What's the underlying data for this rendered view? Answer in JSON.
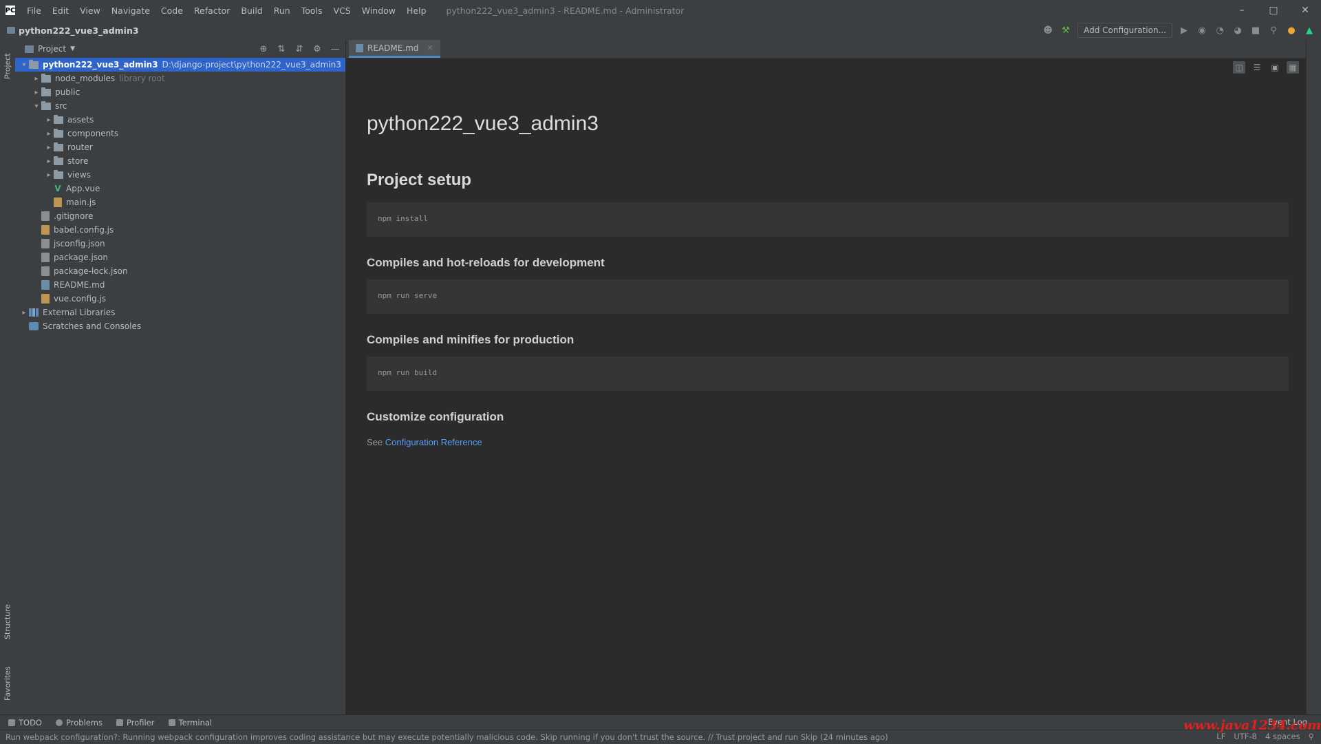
{
  "titlebar": {
    "menu": [
      "File",
      "Edit",
      "View",
      "Navigate",
      "Code",
      "Refactor",
      "Build",
      "Run",
      "Tools",
      "VCS",
      "Window",
      "Help"
    ],
    "window_title": "python222_vue3_admin3 - README.md - Administrator"
  },
  "navbar": {
    "project_name": "python222_vue3_admin3",
    "add_configuration_label": "Add Configuration..."
  },
  "left_stripe": {
    "project_tab": "Project",
    "structure_tab": "Structure",
    "favorites_tab": "Favorites"
  },
  "project_panel": {
    "title": "Project",
    "tree": [
      {
        "label": "python222_vue3_admin3",
        "hint": "D:\\django-project\\python222_vue3_admin3",
        "indent": 0,
        "arrow": "▾",
        "kind": "root",
        "selected": true
      },
      {
        "label": "node_modules",
        "hint": "library root",
        "indent": 1,
        "arrow": "▸",
        "kind": "folder"
      },
      {
        "label": "public",
        "hint": "",
        "indent": 1,
        "arrow": "▸",
        "kind": "folder"
      },
      {
        "label": "src",
        "hint": "",
        "indent": 1,
        "arrow": "▾",
        "kind": "folder"
      },
      {
        "label": "assets",
        "hint": "",
        "indent": 2,
        "arrow": "▸",
        "kind": "folder"
      },
      {
        "label": "components",
        "hint": "",
        "indent": 2,
        "arrow": "▸",
        "kind": "folder"
      },
      {
        "label": "router",
        "hint": "",
        "indent": 2,
        "arrow": "▸",
        "kind": "folder"
      },
      {
        "label": "store",
        "hint": "",
        "indent": 2,
        "arrow": "▸",
        "kind": "folder"
      },
      {
        "label": "views",
        "hint": "",
        "indent": 2,
        "arrow": "▸",
        "kind": "folder"
      },
      {
        "label": "App.vue",
        "hint": "",
        "indent": 2,
        "arrow": "",
        "kind": "vue"
      },
      {
        "label": "main.js",
        "hint": "",
        "indent": 2,
        "arrow": "",
        "kind": "js"
      },
      {
        "label": ".gitignore",
        "hint": "",
        "indent": 1,
        "arrow": "",
        "kind": "git"
      },
      {
        "label": "babel.config.js",
        "hint": "",
        "indent": 1,
        "arrow": "",
        "kind": "js"
      },
      {
        "label": "jsconfig.json",
        "hint": "",
        "indent": 1,
        "arrow": "",
        "kind": "json"
      },
      {
        "label": "package.json",
        "hint": "",
        "indent": 1,
        "arrow": "",
        "kind": "json"
      },
      {
        "label": "package-lock.json",
        "hint": "",
        "indent": 1,
        "arrow": "",
        "kind": "json"
      },
      {
        "label": "README.md",
        "hint": "",
        "indent": 1,
        "arrow": "",
        "kind": "md"
      },
      {
        "label": "vue.config.js",
        "hint": "",
        "indent": 1,
        "arrow": "",
        "kind": "js"
      },
      {
        "label": "External Libraries",
        "hint": "",
        "indent": 0,
        "arrow": "▸",
        "kind": "lib"
      },
      {
        "label": "Scratches and Consoles",
        "hint": "",
        "indent": 0,
        "arrow": "",
        "kind": "scratch"
      }
    ]
  },
  "editor": {
    "tab_label": "README.md",
    "h1": "python222_vue3_admin3",
    "h2": "Project setup",
    "code_install": "npm install",
    "h3_dev": "Compiles and hot-reloads for development",
    "code_serve": "npm run serve",
    "h3_prod": "Compiles and minifies for production",
    "code_build": "npm run build",
    "h3_config": "Customize configuration",
    "see_text": "See ",
    "link_text": "Configuration Reference"
  },
  "bottom_tabs": {
    "todo": "TODO",
    "problems": "Problems",
    "profiler": "Profiler",
    "terminal": "Terminal",
    "event_log": "Event Log"
  },
  "statusbar": {
    "message": "Run webpack configuration?: Running webpack configuration improves coding assistance but may execute potentially malicious code. Skip running if you don't trust the source. // Trust project and run   Skip (24 minutes ago)",
    "line_sep": "LF",
    "encoding": "UTF-8",
    "indent": "4 spaces"
  },
  "watermark": "www.java1234.com",
  "colors": {
    "selection": "#2f65ca",
    "link": "#589df6",
    "background": "#2b2b2b",
    "panel": "#3c3f41"
  }
}
